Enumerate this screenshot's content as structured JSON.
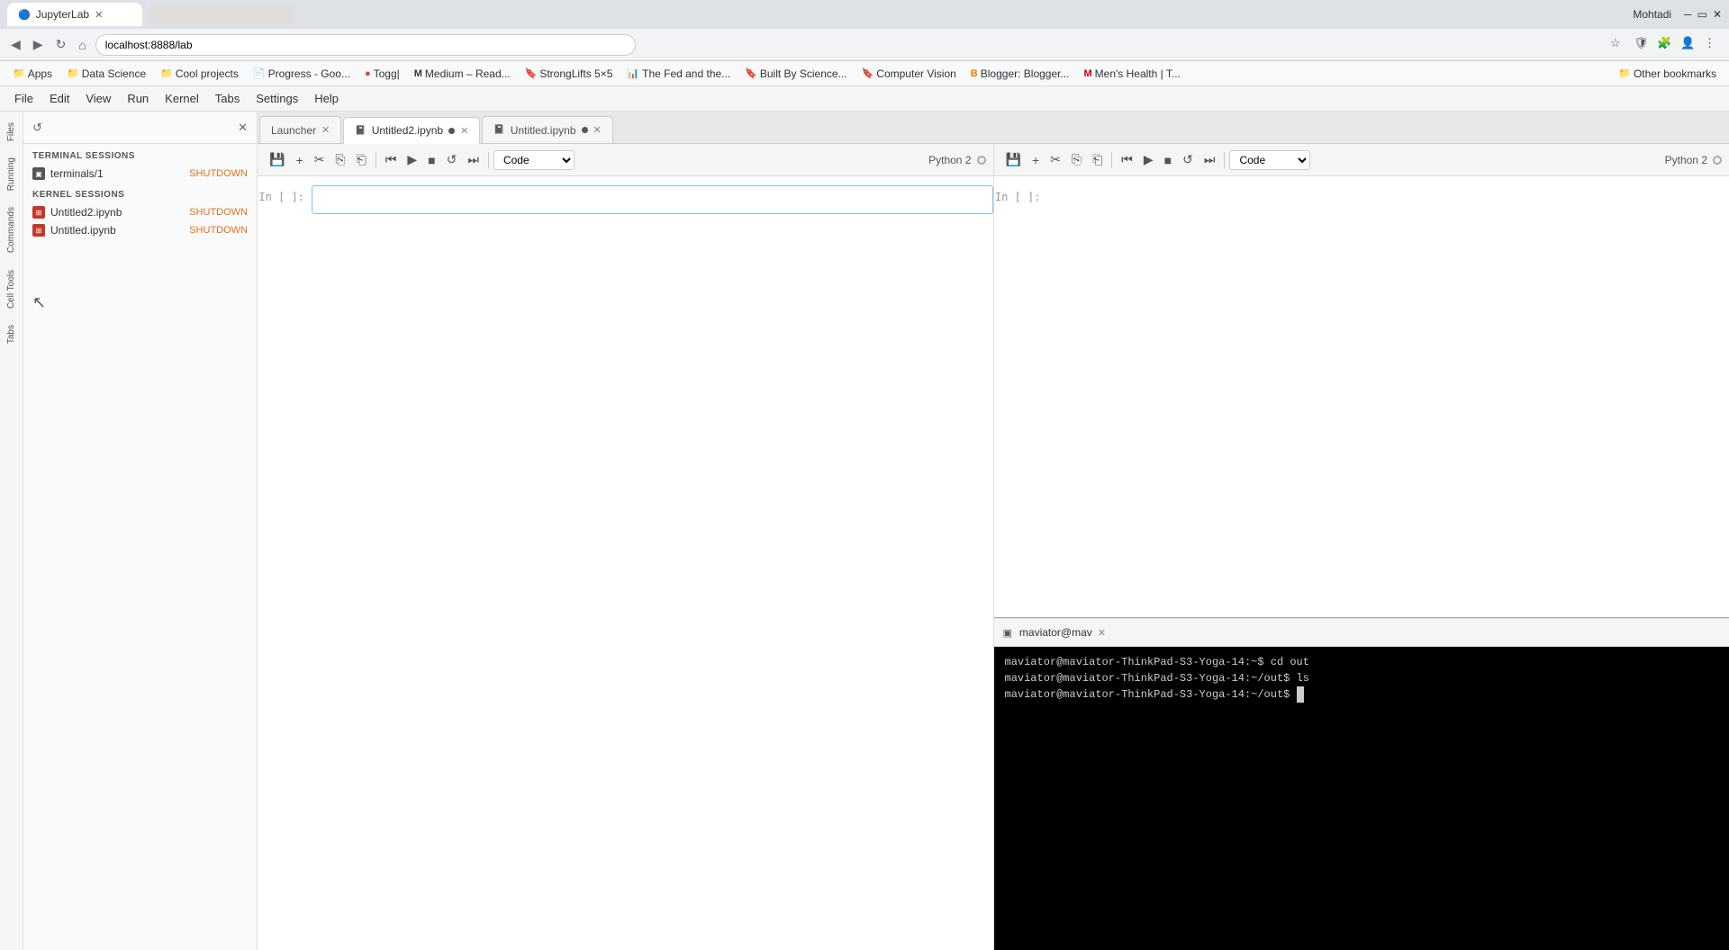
{
  "browser": {
    "tab_title": "JupyterLab",
    "url": "localhost:8888/lab",
    "win_buttons": [
      "minimize",
      "maximize",
      "close"
    ],
    "title_right": "Mohtadi"
  },
  "bookmarks": {
    "items": [
      {
        "label": "Apps",
        "icon": "📁"
      },
      {
        "label": "Data Science",
        "icon": "📁"
      },
      {
        "label": "Cool projects",
        "icon": "📁"
      },
      {
        "label": "Progress - Goo...",
        "icon": "📄"
      },
      {
        "label": "Togg|",
        "icon": "🔖"
      },
      {
        "label": "Medium – Read...",
        "icon": "M"
      },
      {
        "label": "StrongLifts 5×5",
        "icon": "🔖"
      },
      {
        "label": "The Fed and the...",
        "icon": "📊"
      },
      {
        "label": "Built By Science...",
        "icon": "🔖"
      },
      {
        "label": "Computer Vision",
        "icon": "🔖"
      },
      {
        "label": "Blogger: Blogger...",
        "icon": "🅱"
      },
      {
        "label": "Men's Health | T...",
        "icon": "M"
      },
      {
        "label": "Other bookmarks",
        "icon": "📁"
      }
    ]
  },
  "jupyter": {
    "menu_items": [
      "File",
      "Edit",
      "View",
      "Run",
      "Kernel",
      "Tabs",
      "Settings",
      "Help"
    ],
    "sidebar_labels": [
      "Files",
      "Running",
      "Commands",
      "Cell Tools",
      "Tabs"
    ]
  },
  "left_panel": {
    "refresh_label": "↺",
    "close_label": "✕",
    "terminal_sessions_label": "TERMINAL SESSIONS",
    "kernel_sessions_label": "KERNEL SESSIONS",
    "terminals": [
      {
        "name": "terminals/1",
        "status": "SHUTDOWN"
      }
    ],
    "kernels": [
      {
        "name": "Untitled2.ipynb",
        "status": "SHUTDOWN"
      },
      {
        "name": "Untitled.ipynb",
        "status": "SHUTDOWN"
      }
    ]
  },
  "tabs": [
    {
      "label": "Launcher",
      "active": false,
      "modified": false,
      "closeable": true
    },
    {
      "label": "Untitled2.ipynb",
      "active": true,
      "modified": true,
      "closeable": true
    },
    {
      "label": "Untitled.ipynb",
      "active": false,
      "modified": true,
      "closeable": true
    }
  ],
  "toolbar": {
    "save": "💾",
    "add": "+",
    "cut": "✂",
    "copy": "⎘",
    "paste": "⎗",
    "run_prev": "⏮",
    "run": "▶",
    "stop": "■",
    "restart": "↺",
    "restart_run": "⏭",
    "cell_type": "Code",
    "kernel_name": "Python 2"
  },
  "notebook_left": {
    "cell_prompt": "In [ ]:",
    "cell_content": ""
  },
  "notebook_right": {
    "cell_prompt": "In [ ]:",
    "cell_content": ""
  },
  "terminal": {
    "tab_label": "maviator@mav",
    "lines": [
      "maviator@maviator-ThinkPad-S3-Yoga-14:~$ cd out",
      "maviator@maviator-ThinkPad-S3-Yoga-14:~/out$ ls",
      "maviator@maviator-ThinkPad-S3-Yoga-14:~/out$ "
    ]
  }
}
